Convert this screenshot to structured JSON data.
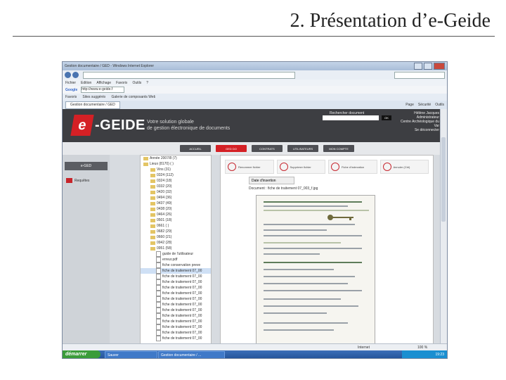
{
  "slide": {
    "title": "2. Présentation d’e-Geide"
  },
  "browser": {
    "window_title": "Gestion documentaire / GED - Windows Internet Explorer",
    "address": "http://www.e-geide.fr/",
    "menu": [
      "Fichier",
      "Edition",
      "Affichage",
      "Favoris",
      "Outils",
      "?"
    ],
    "google_label": "Google",
    "google_value": "http://www.e-geide.f",
    "favorites_label": "Favoris",
    "favorites": [
      "Sites suggérés",
      "Galerie de composants Web"
    ],
    "tab_label": "Gestion documentaire / GED",
    "tab_tools": [
      "Page",
      "Sécurité",
      "Outils"
    ],
    "status_zone": "Internet",
    "zoom": "100 %"
  },
  "app": {
    "logo_e": "e",
    "logo_text": "-GEIDE",
    "tagline_line1": "Votre solution globale",
    "tagline_line2": "de gestion électronique de documents",
    "search_label": "Rechercher document",
    "search_button": "OK",
    "user_line1": "Hélène Jacques",
    "user_line2": "Administrateur",
    "user_line3": "Centre Archéologique du Var",
    "user_line4": "Se déconnecter",
    "nav": [
      "ACCUEIL",
      "GED DO",
      "CONTRATS",
      "UTILISATEURS",
      "MON COMPTE"
    ],
    "left_header": "e-GED",
    "left_item": "Requêtes",
    "tree": [
      "Année 2007/8 (7)",
      "Lieux (8170) ( )",
      "Vins (31)",
      "0324 (112)",
      "0324 (18)",
      "0332 (20)",
      "0420 (32)",
      "0494 (36)",
      "0437 (49)",
      "0438 (20)",
      "0464 (26)",
      "0501 (18)",
      "0661 ( )",
      "0682 (29)",
      "0660 (21)",
      "0942 (28)",
      "0951 (58)",
      "guide de l'utilisateur",
      "erreur.pdf",
      "fiche conservation preve",
      "fiche de traitement 07_00",
      "fiche de traitement 07_00",
      "fiche de traitement 07_00",
      "fiche de traitement 07_00",
      "fiche de traitement 07_00",
      "fiche de traitement 07_00",
      "fiche de traitement 07_00",
      "fiche de traitement 07_00",
      "fiche de traitement 07_00",
      "fiche de traitement 07_00",
      "fiche de traitement 07_00",
      "fiche de traitement 07_00",
      "fiche de traitement 07_00"
    ],
    "actions": [
      "Renommer fichier",
      "Supprimer fichier",
      "Fiche d'indexation",
      "Annuler (Ctrl)"
    ],
    "date_label": "Date d'insertion",
    "doc_caption": "Document : fiche de traitement 07_003_f.jpg"
  },
  "taskbar": {
    "start": "démarrer",
    "tasks": [
      "Sauver",
      "Gestion documentaire / ..."
    ],
    "time": "19:23"
  }
}
